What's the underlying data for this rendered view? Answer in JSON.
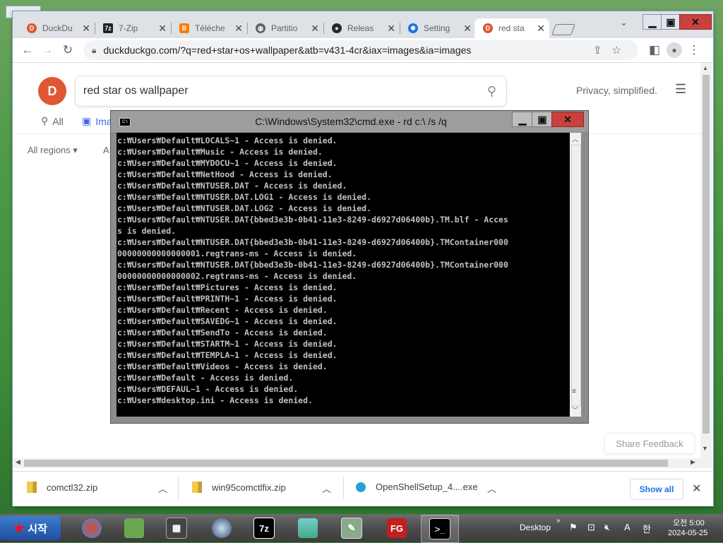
{
  "browser": {
    "tabs": [
      {
        "label": "DuckDu",
        "icon": "duckduckgo-icon",
        "color": "#de5833"
      },
      {
        "label": "7-Zip",
        "icon": "7zip-icon",
        "color": "#222222"
      },
      {
        "label": "Téléche",
        "icon": "blogger-icon",
        "color": "#f57d00"
      },
      {
        "label": "Partitio",
        "icon": "globe-icon",
        "color": "#5f6368"
      },
      {
        "label": "Releas",
        "icon": "github-icon",
        "color": "#24292e"
      },
      {
        "label": "Setting",
        "icon": "gear-icon",
        "color": "#1a73e8"
      },
      {
        "label": "red sta",
        "icon": "duckduckgo-icon",
        "color": "#de5833",
        "active": true
      }
    ],
    "url": "duckduckgo.com/?q=red+star+os+wallpaper&atb=v431-4cr&iax=images&ia=images"
  },
  "ddg": {
    "query": "red star os wallpaper",
    "privacy": "Privacy, simplified.",
    "nav_all": "All",
    "nav_images": "Ima",
    "regions": "All regions  ▾",
    "filter_partial": "A",
    "share_feedback": "Share Feedback"
  },
  "cmd": {
    "title": "C:\\Windows\\System32\\cmd.exe - rd  c:\\ /s /q",
    "lines": [
      "c:₩Users₩Default₩LOCALS~1 - Access is denied.",
      "c:₩Users₩Default₩Music - Access is denied.",
      "c:₩Users₩Default₩MYDOCU~1 - Access is denied.",
      "c:₩Users₩Default₩NetHood - Access is denied.",
      "c:₩Users₩Default₩NTUSER.DAT - Access is denied.",
      "c:₩Users₩Default₩NTUSER.DAT.LOG1 - Access is denied.",
      "c:₩Users₩Default₩NTUSER.DAT.LOG2 - Access is denied.",
      "c:₩Users₩Default₩NTUSER.DAT{bbed3e3b-0b41-11e3-8249-d6927d06400b}.TM.blf - Acces",
      "s is denied.",
      "c:₩Users₩Default₩NTUSER.DAT{bbed3e3b-0b41-11e3-8249-d6927d06400b}.TMContainer000",
      "00000000000000001.regtrans-ms - Access is denied.",
      "c:₩Users₩Default₩NTUSER.DAT{bbed3e3b-0b41-11e3-8249-d6927d06400b}.TMContainer000",
      "00000000000000002.regtrans-ms - Access is denied.",
      "c:₩Users₩Default₩Pictures - Access is denied.",
      "c:₩Users₩Default₩PRINTH~1 - Access is denied.",
      "c:₩Users₩Default₩Recent - Access is denied.",
      "c:₩Users₩Default₩SAVEDG~1 - Access is denied.",
      "c:₩Users₩Default₩SendTo - Access is denied.",
      "c:₩Users₩Default₩STARTM~1 - Access is denied.",
      "c:₩Users₩Default₩TEMPLA~1 - Access is denied.",
      "c:₩Users₩Default₩Videos - Access is denied.",
      "c:₩Users₩Default - Access is denied.",
      "c:₩Users₩DEFAUL~1 - Access is denied.",
      "c:₩Users₩desktop.ini - Access is denied."
    ]
  },
  "downloads": {
    "items": [
      "comctl32.zip",
      "win95comctlfix.zip",
      "OpenShellSetup_4....exe"
    ],
    "show_all": "Show all"
  },
  "taskbar": {
    "start": "시작",
    "desktop": "Desktop",
    "apps": [
      "browser-icon",
      "mahjong-icon",
      "video-icon",
      "globe-icon",
      "7zip-icon",
      "photo-icon",
      "tools-icon",
      "fg-icon",
      "cmd-icon"
    ],
    "ime": "A",
    "ime_kr": "한",
    "time": "오전 5:00",
    "date": "2024-05-25"
  }
}
